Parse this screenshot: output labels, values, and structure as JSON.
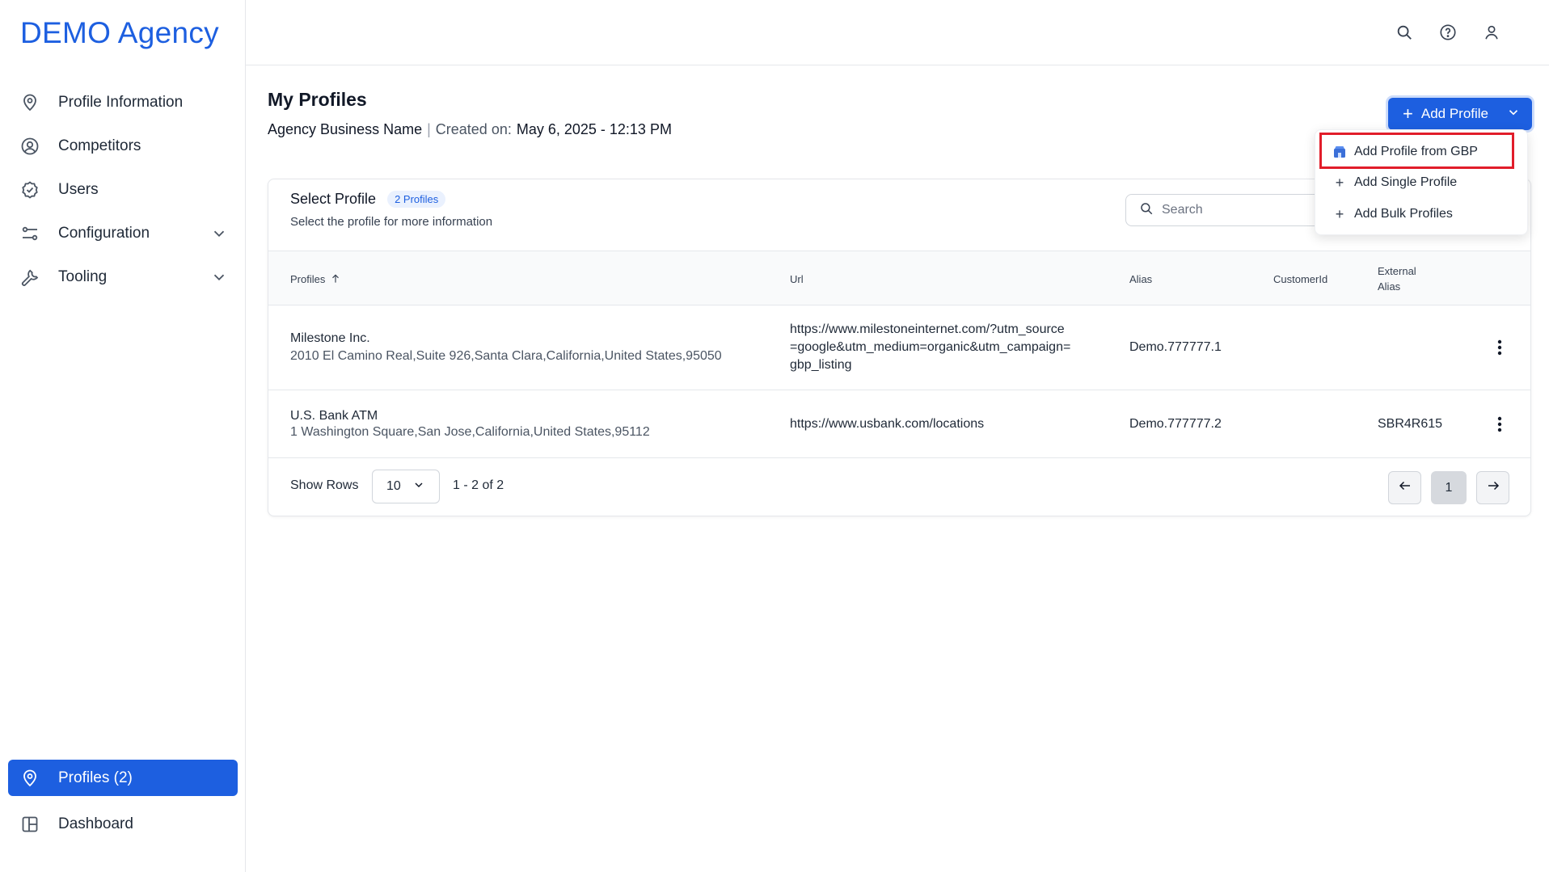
{
  "brand": "DEMO Agency",
  "sidebar": {
    "items": [
      {
        "label": "Profile Information",
        "icon": "map-pin-icon"
      },
      {
        "label": "Competitors",
        "icon": "user-circle-icon"
      },
      {
        "label": "Users",
        "icon": "check-badge-icon"
      },
      {
        "label": "Configuration",
        "icon": "sliders-icon",
        "expandable": true
      },
      {
        "label": "Tooling",
        "icon": "wrench-icon",
        "expandable": true
      }
    ],
    "bottom": [
      {
        "label": "Profiles (2)",
        "icon": "map-pin-icon",
        "active": true
      },
      {
        "label": "Dashboard",
        "icon": "layout-icon"
      }
    ]
  },
  "topbar": {
    "icons": [
      "search-icon",
      "help-icon",
      "user-icon"
    ]
  },
  "header": {
    "title": "My Profiles",
    "business_name": "Agency Business Name",
    "separator": "|",
    "created_label": "Created on:",
    "created_value": "May 6, 2025 - 12:13 PM"
  },
  "add_button": {
    "label": "Add Profile"
  },
  "dropdown": {
    "items": [
      {
        "label": "Add Profile from GBP",
        "icon": "gbp-icon"
      },
      {
        "label": "Add Single Profile",
        "icon": "plus-icon"
      },
      {
        "label": "Add Bulk Profiles",
        "icon": "plus-icon"
      }
    ]
  },
  "card": {
    "title": "Select Profile",
    "badge": "2 Profiles",
    "description": "Select the profile for more information",
    "search_placeholder": "Search"
  },
  "table": {
    "columns": {
      "profiles": "Profiles",
      "url": "Url",
      "alias": "Alias",
      "customer_id": "CustomerId",
      "external_alias_1": "External",
      "external_alias_2": "Alias"
    },
    "rows": [
      {
        "name": "Milestone Inc.",
        "address": "2010 El Camino Real,Suite 926,Santa Clara,California,United States,95050",
        "url_1": "https://www.milestoneinternet.com/?utm_source",
        "url_2": "=google&utm_medium=organic&utm_campaign=",
        "url_3": "gbp_listing",
        "alias": "Demo.777777.1",
        "customer_id": "",
        "external_alias": ""
      },
      {
        "name": "U.S. Bank ATM",
        "address": "1 Washington Square,San Jose,California,United States,95112",
        "url_1": "https://www.usbank.com/locations",
        "alias": "Demo.777777.2",
        "customer_id": "",
        "external_alias": "SBR4R615"
      }
    ]
  },
  "footer": {
    "show_rows_label": "Show Rows",
    "rows_value": "10",
    "range": "1 - 2 of 2",
    "current_page": "1"
  },
  "colors": {
    "accent": "#1d5fe0",
    "highlight": "#e11d2a"
  }
}
